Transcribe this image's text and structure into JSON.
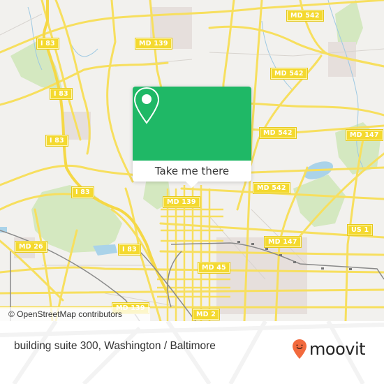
{
  "map": {
    "attribution": "© OpenStreetMap contributors",
    "colors": {
      "background": "#f2f1ee",
      "road": "#f7df5e",
      "park": "#cde6b4",
      "water": "#a9d3ea",
      "building": "#e4dddb",
      "rail": "#888888",
      "shield": "#f4d92f"
    },
    "road_labels": [
      {
        "text": "I 83"
      },
      {
        "text": "MD 139"
      },
      {
        "text": "MD 542"
      },
      {
        "text": "I 83"
      },
      {
        "text": "MD 542"
      },
      {
        "text": "I 83"
      },
      {
        "text": "MD 542"
      },
      {
        "text": "MD 147"
      },
      {
        "text": "I 83"
      },
      {
        "text": "MD 542"
      },
      {
        "text": "MD 139"
      },
      {
        "text": "US 1"
      },
      {
        "text": "MD 26"
      },
      {
        "text": "I 83"
      },
      {
        "text": "MD 147"
      },
      {
        "text": "MD 45"
      },
      {
        "text": "MD 139"
      },
      {
        "text": "MD 2"
      }
    ]
  },
  "popup": {
    "icon": "location-pin-icon",
    "button_label": "Take me there",
    "accent_color": "#1fb866"
  },
  "footer": {
    "place_title": "building suite 300, Washington / Baltimore",
    "brand": {
      "name": "moovit",
      "icon": "moovit-pin-icon",
      "color": "#f26a3d"
    }
  }
}
